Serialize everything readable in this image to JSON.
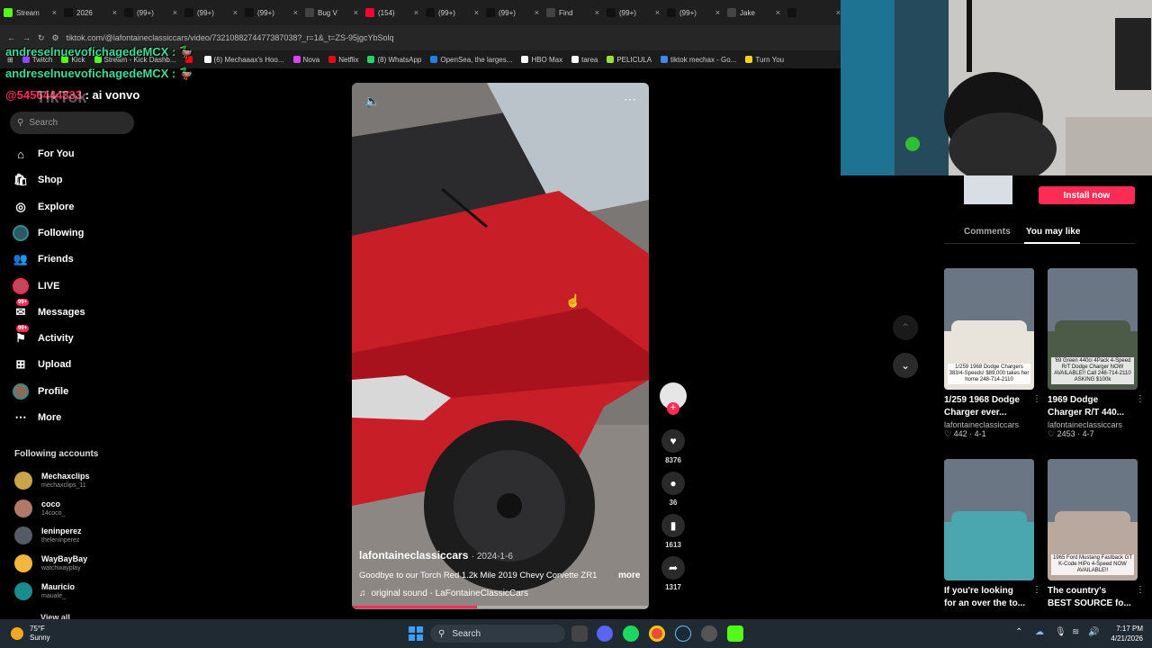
{
  "browser": {
    "tabs": [
      {
        "label": "Stream",
        "color": "#53fc18"
      },
      {
        "label": "2026",
        "color": "#111111"
      },
      {
        "label": "(99+)",
        "color": "#111111"
      },
      {
        "label": "(99+)",
        "color": "#111111"
      },
      {
        "label": "(99+)",
        "color": "#111111"
      },
      {
        "label": "Bug V",
        "color": "#444444"
      },
      {
        "label": "(154)",
        "color": "#ff0033"
      },
      {
        "label": "(99+)",
        "color": "#111111"
      },
      {
        "label": "(99+)",
        "color": "#111111"
      },
      {
        "label": "Find",
        "color": "#444444"
      },
      {
        "label": "(99+)",
        "color": "#111111"
      },
      {
        "label": "(99+)",
        "color": "#111111"
      },
      {
        "label": "Jake",
        "color": "#444444"
      },
      {
        "label": "",
        "color": "#111111"
      }
    ],
    "url": "tiktok.com/@lafontaineclassiccars/video/7321088274477387038?_r=1&_t=ZS-95jgcYbSolq",
    "bookmarks": [
      {
        "label": "Twitch",
        "color": "#9146ff"
      },
      {
        "label": "Kick",
        "color": "#53fc18"
      },
      {
        "label": "Stream - Kick Dashb...",
        "color": "#53fc18"
      },
      {
        "label": "",
        "color": "#ff0000"
      },
      {
        "label": "(6) Mechaaax's Hoo...",
        "color": "#ffffff"
      },
      {
        "label": "Nova",
        "color": "#e040fb"
      },
      {
        "label": "Netflix",
        "color": "#e50914"
      },
      {
        "label": "(8) WhatsApp",
        "color": "#25d366"
      },
      {
        "label": "OpenSea, the larges...",
        "color": "#2081e2"
      },
      {
        "label": "HBO Max",
        "color": "#ffffff"
      },
      {
        "label": "tarea",
        "color": "#ffffff"
      },
      {
        "label": "PELICULA",
        "color": "#9cde3a"
      },
      {
        "label": "tiktok mechax - Go...",
        "color": "#4285f4"
      },
      {
        "label": "Turn You",
        "color": "#f7d21c"
      }
    ]
  },
  "chat": {
    "line1": "andreselnuevofichagedeMCX :",
    "line2": "andreselnuevofichagedeMCX :",
    "line3_user": "@5456444333",
    "line3_msg": ": ai vonvo"
  },
  "sidebar": {
    "logo": "TikTok",
    "search_placeholder": "Search",
    "nav": [
      {
        "label": "For You",
        "icon": "home-icon",
        "glyph": "⌂",
        "badge": ""
      },
      {
        "label": "Shop",
        "icon": "shop-icon",
        "glyph": "🛍",
        "badge": ""
      },
      {
        "label": "Explore",
        "icon": "compass-icon",
        "glyph": "◎",
        "badge": ""
      },
      {
        "label": "Following",
        "icon": "avatar-icon",
        "glyph": "●",
        "badge": ""
      },
      {
        "label": "Friends",
        "icon": "friends-icon",
        "glyph": "👥",
        "badge": ""
      },
      {
        "label": "LIVE",
        "icon": "live-avatar-icon",
        "glyph": "●",
        "badge": ""
      },
      {
        "label": "Messages",
        "icon": "message-icon",
        "glyph": "✉",
        "badge": "99+"
      },
      {
        "label": "Activity",
        "icon": "activity-icon",
        "glyph": "⚑",
        "badge": "99+"
      },
      {
        "label": "Upload",
        "icon": "upload-icon",
        "glyph": "⊞",
        "badge": ""
      },
      {
        "label": "Profile",
        "icon": "profile-avatar-icon",
        "glyph": "●",
        "badge": ""
      },
      {
        "label": "More",
        "icon": "more-icon",
        "glyph": "⋯",
        "badge": ""
      }
    ],
    "following_title": "Following accounts",
    "following": [
      {
        "name": "Mechaxclips",
        "handle": "mechaxclips_11",
        "color": "#c9a44a"
      },
      {
        "name": "coco",
        "handle": "14coco_",
        "color": "#b07a66"
      },
      {
        "name": "leninperez",
        "handle": "thelenínperez",
        "color": "#555b66"
      },
      {
        "name": "WayBayBay",
        "handle": "watchwayplay",
        "color": "#f2b63c"
      },
      {
        "name": "Mauricio",
        "handle": "mauale_",
        "color": "#1b8c8c"
      }
    ],
    "view_all": "View all"
  },
  "video": {
    "author": "lafontaineclassiccars",
    "date": "· 2024-1-6",
    "caption": "Goodbye to our Torch Red 1.2k Mile 2019 Chevy Corvette ZR1",
    "more": "more",
    "sound": "original sound - LaFontaineClassicCars",
    "progress": 0.42
  },
  "actions": {
    "likes": "8376",
    "comments": "36",
    "saves": "1613",
    "shares": "1317"
  },
  "right": {
    "install": "Install now",
    "tab_comments": "Comments",
    "tab_youmaylike": "You may like",
    "cards": [
      {
        "title1": "1/259 1968 Dodge",
        "title2": "Charger ever...",
        "author": "lafontaineclassiccars",
        "stats": "♡ 442 · 4-1",
        "thumb": "1/259 1968 Dodge Chargers 383/4-Speeds! $89,000 takes her home 248-714-2110",
        "color": "#e8e4dc"
      },
      {
        "title1": "1969 Dodge",
        "title2": "Charger R/T 440...",
        "author": "lafontaineclassiccars",
        "stats": "♡ 2453 · 4-7",
        "thumb": "'69 Green 440ci 4Pack 4-Speed R/T Dodge Charger NOW AVAILABLE!! Call 248-714-2110 ASKING $100k",
        "color": "#4c5a48"
      },
      {
        "title1": "If you're looking",
        "title2": "for an over the to...",
        "author": "",
        "stats": "",
        "thumb": "",
        "color": "#4aa7b0"
      },
      {
        "title1": "The country's",
        "title2": "BEST SOURCE fo...",
        "author": "",
        "stats": "",
        "thumb": "1965 Ford Mustang Fastback GT K-Code HiPo 4-Speed NOW AVAILABLE!!",
        "color": "#b9a89e"
      }
    ]
  },
  "taskbar": {
    "weather_temp": "75°F",
    "weather_desc": "Sunny",
    "search": "Search",
    "time": "7:17 PM",
    "date": "4/21/2026"
  }
}
